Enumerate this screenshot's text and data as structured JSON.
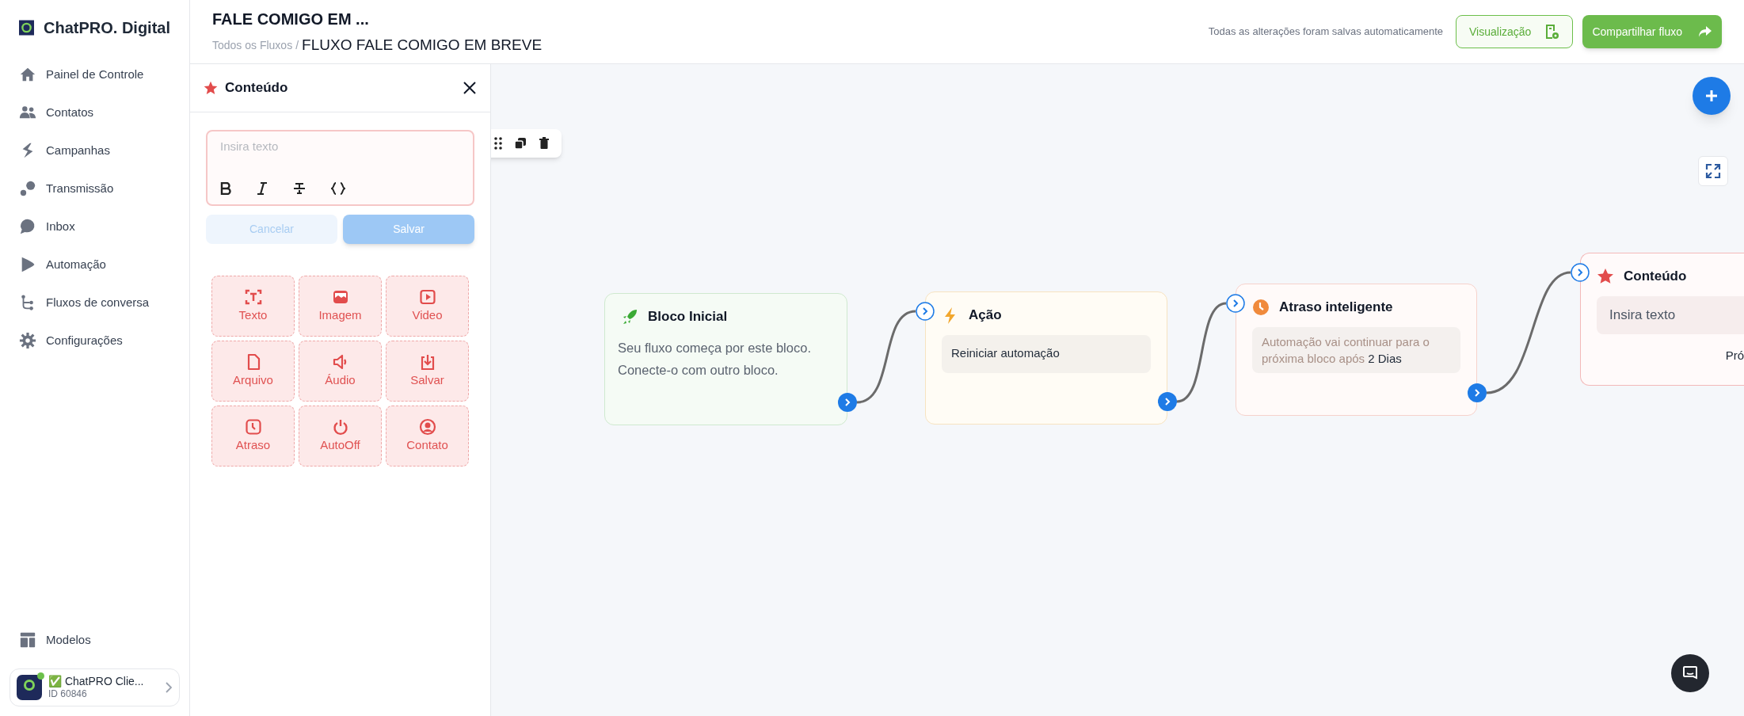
{
  "brand": {
    "name": "ChatPRO. Digital"
  },
  "sidebar": {
    "items": [
      {
        "label": "Painel de Controle"
      },
      {
        "label": "Contatos"
      },
      {
        "label": "Campanhas"
      },
      {
        "label": "Transmissão"
      },
      {
        "label": "Inbox"
      },
      {
        "label": "Automação"
      },
      {
        "label": "Fluxos de conversa"
      },
      {
        "label": "Configurações"
      }
    ],
    "bottom_items": [
      {
        "label": "Modelos"
      }
    ],
    "account": {
      "name": "✅ ChatPRO Clie...",
      "id": "ID 60846",
      "online": true
    }
  },
  "header": {
    "title": "FALE COMIGO EM ...",
    "breadcrumb": [
      "Todos os Fluxos",
      "FLUXO FALE COMIGO EM BREVE"
    ],
    "breadcrumb_separator": "/",
    "save_status": "Todas as alterações foram salvas automaticamente",
    "buttons": [
      {
        "label": "Visualização",
        "kind": "outline"
      },
      {
        "label": "Compartilhar fluxo",
        "kind": "primary"
      }
    ]
  },
  "panel": {
    "title": "Conteúdo",
    "editor": {
      "placeholder": "Insira texto"
    },
    "actions": [
      {
        "label": "Cancelar",
        "kind": "secondary",
        "disabled": true
      },
      {
        "label": "Salvar",
        "kind": "primary",
        "disabled": true
      }
    ],
    "tiles": [
      {
        "label": "Texto"
      },
      {
        "label": "Imagem"
      },
      {
        "label": "Video"
      },
      {
        "label": "Arquivo"
      },
      {
        "label": "Áudio"
      },
      {
        "label": "Salvar"
      },
      {
        "label": "Atraso"
      },
      {
        "label": "AutoOff"
      },
      {
        "label": "Contato"
      }
    ]
  },
  "canvas": {
    "nodes": [
      {
        "kind": "start",
        "title": "Bloco Inicial",
        "text": "Seu fluxo começa por este bloco. Conecte-o com outro bloco."
      },
      {
        "kind": "action",
        "title": "Ação",
        "field": "Reiniciar automação"
      },
      {
        "kind": "delay",
        "title": "Atraso inteligente",
        "text": "Automação vai continuar para o próxima bloco após",
        "value": "2 Dias"
      },
      {
        "kind": "content",
        "title": "Conteúdo",
        "preview": "Insira texto",
        "footer": "Pró"
      }
    ]
  }
}
